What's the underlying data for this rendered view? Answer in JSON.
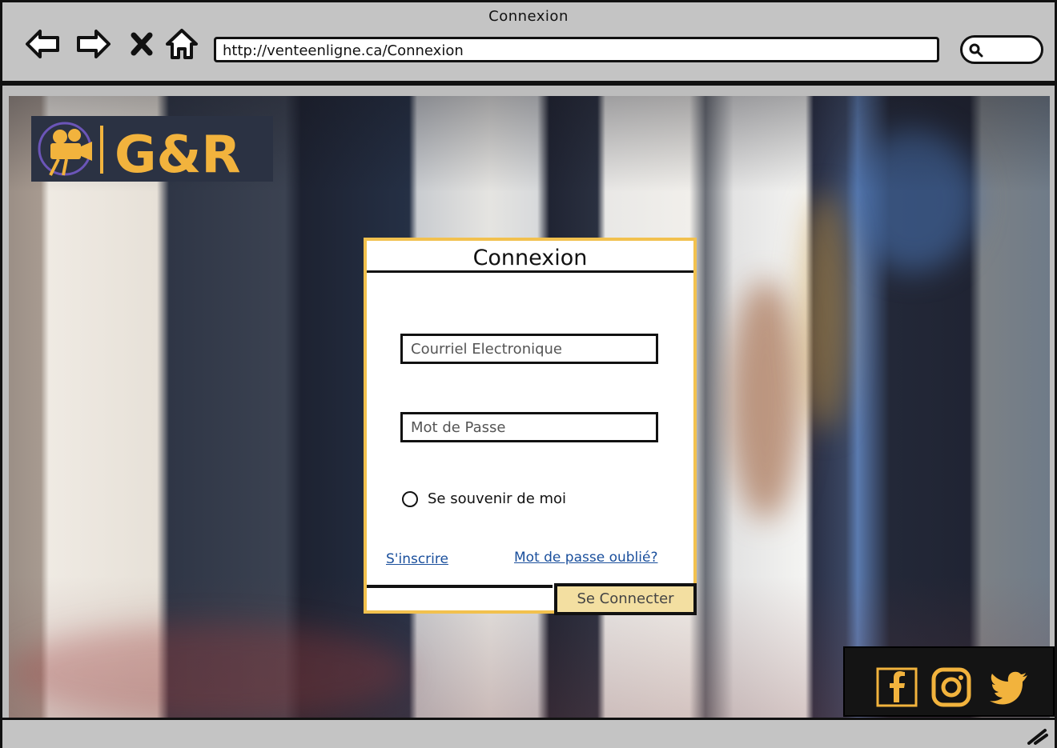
{
  "window": {
    "title": "Connexion"
  },
  "nav": {
    "back_icon": "back-arrow-icon",
    "forward_icon": "forward-arrow-icon",
    "stop_icon": "close-icon",
    "home_icon": "home-icon"
  },
  "address_bar": {
    "url": "http://venteenligne.ca/Connexion"
  },
  "search": {
    "icon": "search-icon"
  },
  "logo": {
    "text": "G&R",
    "icon": "movie-camera-icon",
    "color": "#f2b33d"
  },
  "login": {
    "title": "Connexion",
    "email_placeholder": "Courriel Electronique",
    "password_placeholder": "Mot de Passe",
    "remember_label": "Se souvenir de moi",
    "signup_link": "S'inscrire",
    "forgot_link": "Mot de passe oublié?",
    "submit_label": "Se Connecter"
  },
  "social": {
    "items": [
      "facebook-icon",
      "instagram-icon",
      "twitter-icon"
    ],
    "color": "#f2b33d"
  },
  "colors": {
    "accent": "#f2c14e",
    "button_bg": "#f3dfa1",
    "link": "#1a4f9c"
  }
}
